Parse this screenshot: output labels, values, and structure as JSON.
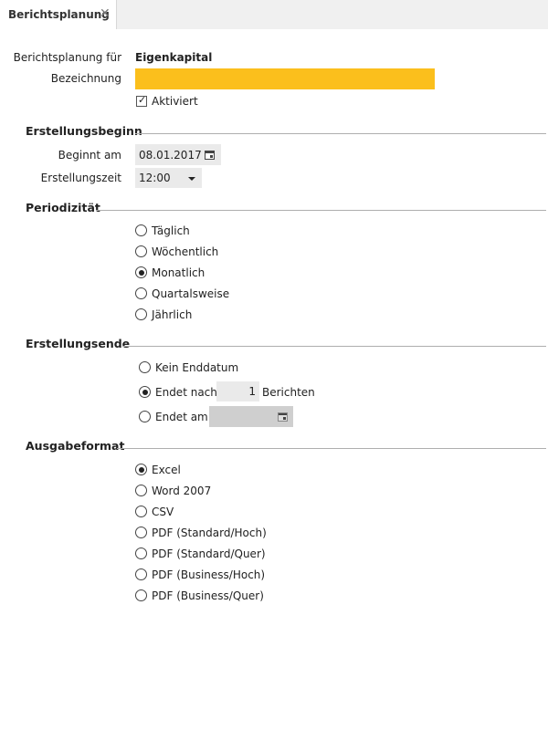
{
  "tab": {
    "label": "Berichtsplanung",
    "close": "✕"
  },
  "form": {
    "planning_for_label": "Berichtsplanung für",
    "planning_for_value": "Eigenkapital",
    "name_label": "Bezeichnung",
    "name_value": "",
    "active_label": "Aktiviert",
    "active_checked": true
  },
  "sections": {
    "start": "Erstellungsbeginn",
    "period": "Periodizität",
    "end": "Erstellungsende",
    "output": "Ausgabeformat"
  },
  "start": {
    "begin_label": "Beginnt am",
    "begin_value": "08.01.2017",
    "time_label": "Erstellungszeit",
    "time_value": "12:00"
  },
  "period": {
    "options": [
      "Täglich",
      "Wöchentlich",
      "Monatlich",
      "Quartalsweise",
      "Jährlich"
    ],
    "selected": "Monatlich"
  },
  "end": {
    "no_end_label": "Kein Enddatum",
    "after_label": "Endet nach",
    "after_count": "1",
    "after_unit": "Berichten",
    "on_label": "Endet am",
    "on_value": "",
    "selected": "Endet nach"
  },
  "output": {
    "options": [
      "Excel",
      "Word 2007",
      "CSV",
      "PDF (Standard/Hoch)",
      "PDF (Standard/Quer)",
      "PDF (Business/Hoch)",
      "PDF (Business/Quer)"
    ],
    "selected": "Excel"
  }
}
